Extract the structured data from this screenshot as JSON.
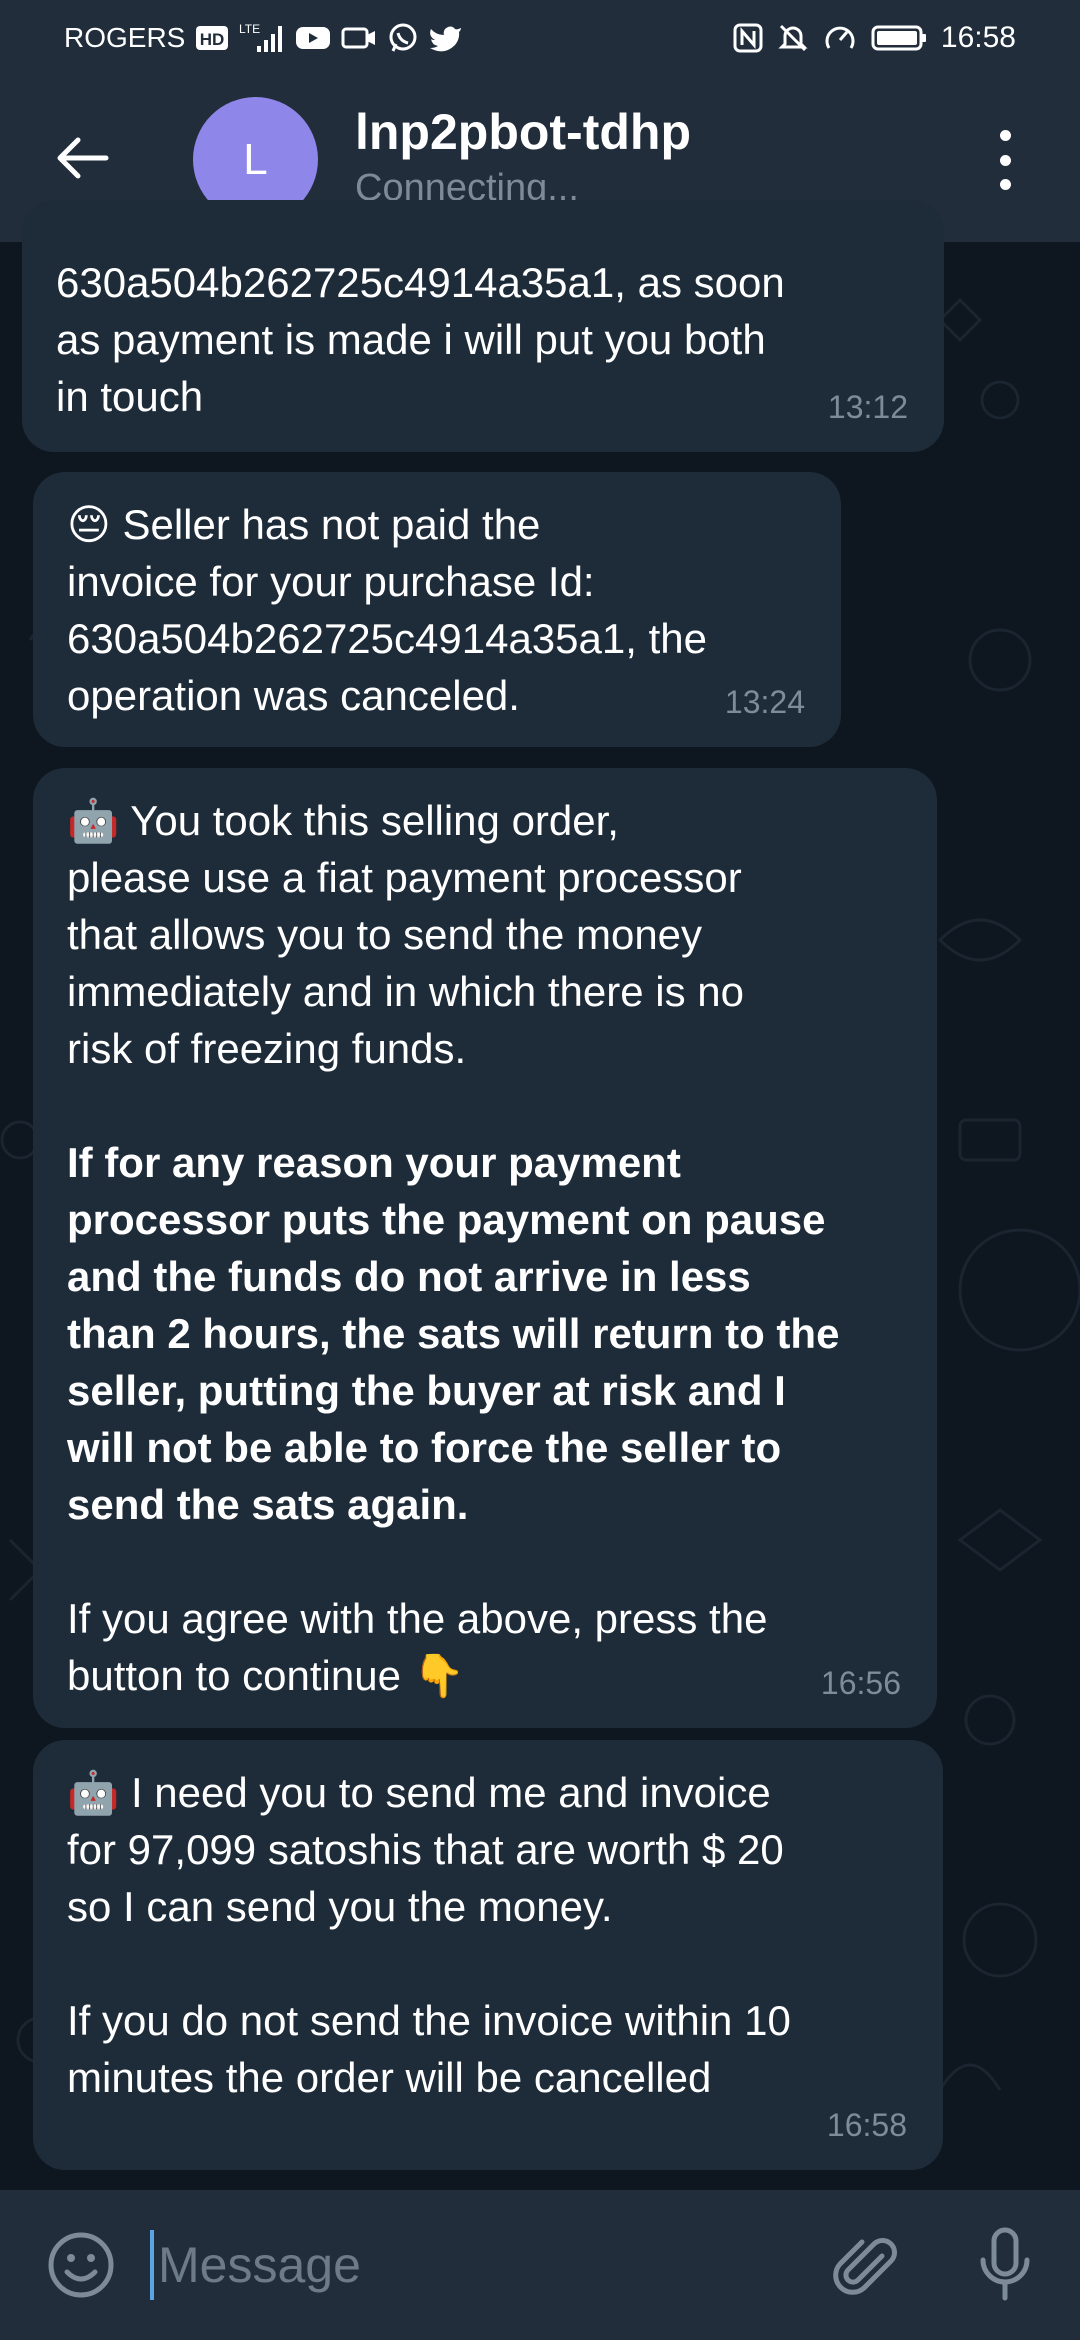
{
  "status_bar": {
    "carrier": "ROGERS",
    "hd_badge": "HD",
    "network": "LTE",
    "time": "16:58"
  },
  "header": {
    "avatar_letter": "L",
    "title": "lnp2pbot-tdhp",
    "status": "Connecting..."
  },
  "messages": [
    {
      "text": "630a504b262725c4914a35a1, as soon\nas payment is made i will put you both\nin touch",
      "time": "13:12"
    },
    {
      "emoji": "😔",
      "text": " Seller has not paid the\ninvoice for your purchase Id:\n630a504b262725c4914a35a1, the\noperation was canceled.",
      "time": "13:24"
    },
    {
      "emoji": "🤖",
      "text": " You took this selling order,\nplease use a fiat payment processor\nthat allows you to send the money\nimmediately and in which there is no\nrisk of freezing funds.",
      "bold_text": "If for any reason your payment\nprocessor puts the payment on pause\nand the funds do not arrive in less\nthan 2 hours, the sats will return to the\nseller, putting the buyer at risk and I\nwill not be able to force the seller to\nsend the sats again.",
      "text_after": "If you agree with the above, press the\nbutton to continue ",
      "trailing_emoji": "👇",
      "time": "16:56"
    },
    {
      "emoji": "🤖",
      "text": " I need you to send me and invoice\nfor 97,099 satoshis that are worth $ 20\nso I can send you the money.",
      "text_after": "If you do not send the invoice within 10\nminutes the order will be cancelled",
      "time": "16:58"
    }
  ],
  "composer": {
    "placeholder": "Message"
  },
  "colors": {
    "bubble": "#1e2c3a",
    "header": "#212d3b",
    "background": "#0e1620",
    "avatar": "#8e86e8",
    "accent": "#5aa3e4"
  },
  "icons": {
    "back": "arrow-left-icon",
    "menu": "more-vertical-icon",
    "emoji": "smile-icon",
    "attach": "paperclip-icon",
    "mic": "microphone-icon"
  }
}
